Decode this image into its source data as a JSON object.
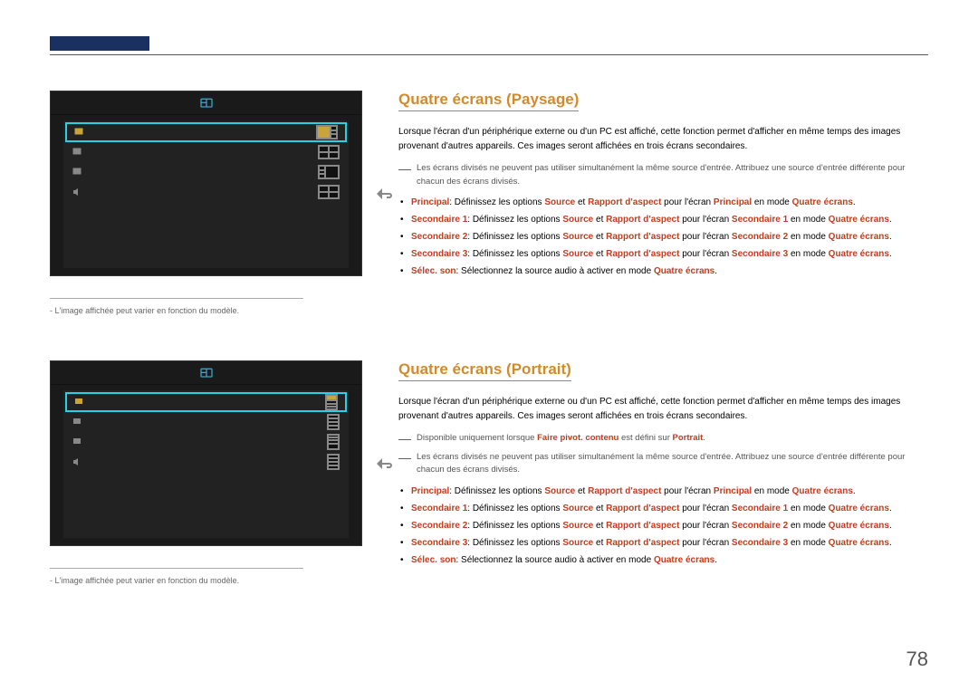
{
  "page_number": "78",
  "caption": "L'image affichée peut varier en fonction du modèle.",
  "section1": {
    "heading": "Quatre écrans (Paysage)",
    "intro": "Lorsque l'écran d'un périphérique externe ou d'un PC est affiché, cette fonction permet d'afficher en même temps des images provenant d'autres appareils. Ces images seront affichées en trois écrans secondaires.",
    "note1": "Les écrans divisés ne peuvent pas utiliser simultanément la même source d'entrée. Attribuez une source d'entrée différente pour chacun des écrans divisés.",
    "bullets": [
      {
        "b": "Principal",
        "t1": ": Définissez les options ",
        "h1": "Source",
        "t2": " et ",
        "h2": "Rapport d'aspect",
        "t3": " pour l'écran ",
        "h3": "Principal",
        "t4": " en mode ",
        "h4": "Quatre écrans",
        "t5": "."
      },
      {
        "b": "Secondaire 1",
        "t1": ": Définissez les options ",
        "h1": "Source",
        "t2": " et ",
        "h2": "Rapport d'aspect",
        "t3": " pour l'écran ",
        "h3": "Secondaire 1",
        "t4": " en mode ",
        "h4": "Quatre écrans",
        "t5": "."
      },
      {
        "b": "Secondaire 2",
        "t1": ": Définissez les options ",
        "h1": "Source",
        "t2": " et ",
        "h2": "Rapport d'aspect",
        "t3": " pour l'écran ",
        "h3": "Secondaire 2",
        "t4": " en mode ",
        "h4": "Quatre écrans",
        "t5": "."
      },
      {
        "b": "Secondaire 3",
        "t1": ": Définissez les options ",
        "h1": "Source",
        "t2": " et ",
        "h2": "Rapport d'aspect",
        "t3": " pour l'écran ",
        "h3": "Secondaire 3",
        "t4": " en mode ",
        "h4": "Quatre écrans",
        "t5": "."
      },
      {
        "b": "Sélec. son",
        "t1": ": Sélectionnez la source audio à activer en mode ",
        "h1": "Quatre écrans",
        "t2": ".",
        "h2": "",
        "t3": "",
        "h3": "",
        "t4": "",
        "h4": "",
        "t5": ""
      }
    ]
  },
  "section2": {
    "heading": "Quatre écrans (Portrait)",
    "intro": "Lorsque l'écran d'un périphérique externe ou d'un PC est affiché, cette fonction permet d'afficher en même temps des images provenant d'autres appareils. Ces images seront affichées en trois écrans secondaires.",
    "note0a": "Disponible uniquement lorsque ",
    "note0b": "Faire pivot. contenu",
    "note0c": " est défini sur ",
    "note0d": "Portrait",
    "note0e": ".",
    "note1": "Les écrans divisés ne peuvent pas utiliser simultanément la même source d'entrée. Attribuez une source d'entrée différente pour chacun des écrans divisés.",
    "bullets": [
      {
        "b": "Principal",
        "t1": ": Définissez les options ",
        "h1": "Source",
        "t2": " et ",
        "h2": "Rapport d'aspect",
        "t3": " pour l'écran ",
        "h3": "Principal",
        "t4": " en mode ",
        "h4": "Quatre écrans",
        "t5": "."
      },
      {
        "b": "Secondaire 1",
        "t1": ": Définissez les options ",
        "h1": "Source",
        "t2": " et ",
        "h2": "Rapport d'aspect",
        "t3": " pour l'écran ",
        "h3": "Secondaire 1",
        "t4": " en mode ",
        "h4": "Quatre écrans",
        "t5": "."
      },
      {
        "b": "Secondaire 2",
        "t1": ": Définissez les options ",
        "h1": "Source",
        "t2": " et ",
        "h2": "Rapport d'aspect",
        "t3": " pour l'écran ",
        "h3": "Secondaire 2",
        "t4": " en mode ",
        "h4": "Quatre écrans",
        "t5": "."
      },
      {
        "b": "Secondaire 3",
        "t1": ": Définissez les options ",
        "h1": "Source",
        "t2": " et ",
        "h2": "Rapport d'aspect",
        "t3": " pour l'écran ",
        "h3": "Secondaire 3",
        "t4": " en mode ",
        "h4": "Quatre écrans",
        "t5": "."
      },
      {
        "b": "Sélec. son",
        "t1": ": Sélectionnez la source audio à activer en mode ",
        "h1": "Quatre écrans",
        "t2": ".",
        "h2": "",
        "t3": "",
        "h3": "",
        "t4": "",
        "h4": "",
        "t5": ""
      }
    ]
  }
}
